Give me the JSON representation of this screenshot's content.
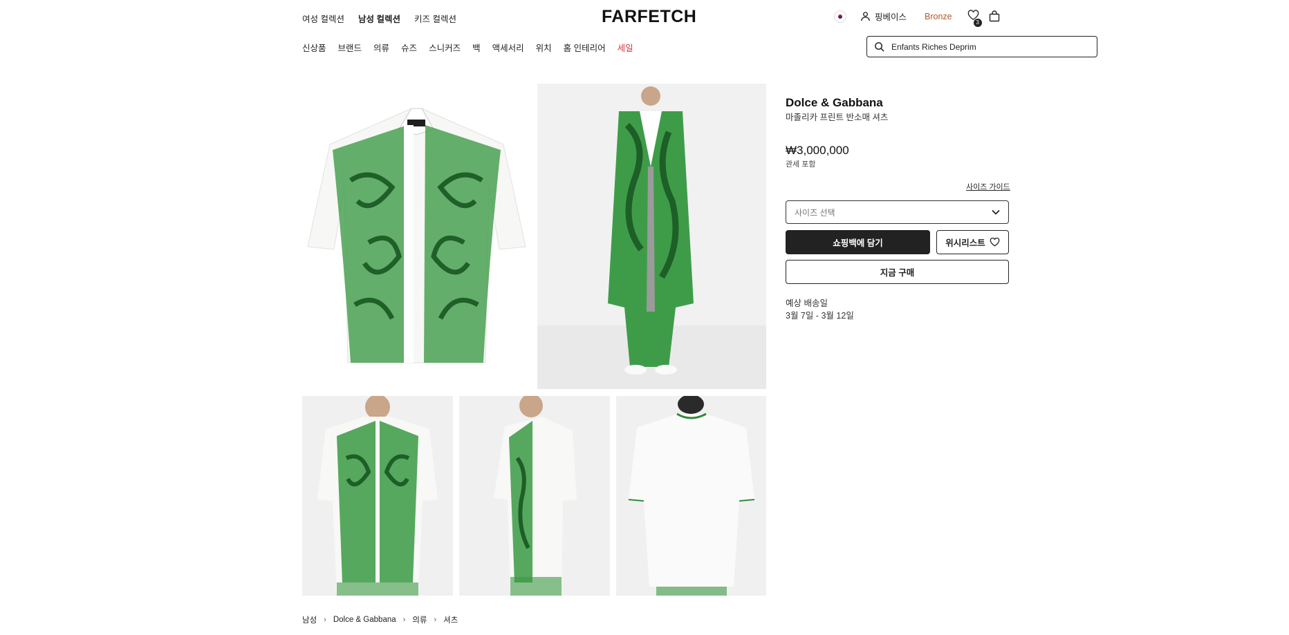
{
  "header": {
    "collections": [
      "여성 컬렉션",
      "남성 컬렉션",
      "키즈 컬렉션"
    ],
    "logo": "FARFETCH",
    "user_name": "핑베이스",
    "tier": "Bronze",
    "wishlist_count": "3",
    "icons": [
      "korea-flag-icon",
      "user-icon",
      "heart-icon",
      "bag-icon",
      "search-icon"
    ]
  },
  "categories": [
    "신상품",
    "브랜드",
    "의류",
    "슈즈",
    "스니커즈",
    "백",
    "액세서리",
    "위치",
    "홈 인테리어",
    "세일"
  ],
  "search": {
    "value": "Enfants Riches Deprim"
  },
  "product": {
    "brand": "Dolce & Gabbana",
    "name": "마졸리카 프린트 반소매 셔츠",
    "price": "₩3,000,000",
    "duty_note": "관세 포함",
    "size_guide": "사이즈 가이드",
    "size_select": "사이즈 선택",
    "add_to_bag": "쇼핑백에 담기",
    "wishlist": "위시리스트",
    "buy_now": "지금 구매",
    "delivery_label": "예상 배송일",
    "delivery_dates": "3월 7일 - 3월 12일"
  },
  "breadcrumb": [
    "남성",
    "Dolce & Gabbana",
    "의류",
    "셔츠"
  ],
  "colors": {
    "sale": "#d0313d",
    "tier": "#b4562e",
    "print_green": "#2f8a3b",
    "dark": "#222222"
  }
}
